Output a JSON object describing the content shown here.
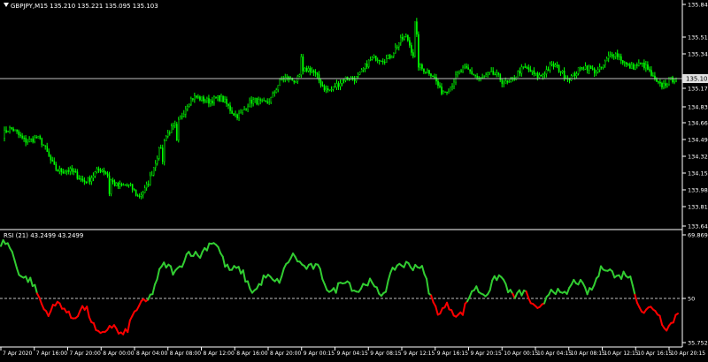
{
  "price_chart": {
    "header_text": "GBPJPY,M15  135.210 135.221 135.095 135.103",
    "y_ticks": [
      "135.845",
      "135.510",
      "135.340",
      "135.170",
      "134.830",
      "134.660",
      "134.490",
      "134.320",
      "134.150",
      "133.980",
      "133.810",
      "133.645"
    ],
    "current_price": "135.103",
    "candle_color": "#00ff00",
    "price_line_color": "#c0c0c0"
  },
  "rsi_panel": {
    "header_text": "RSI (21) 43.2499 43.2499",
    "y_ticks": [
      "69.8691",
      "50",
      "35.752"
    ],
    "level": 50,
    "up_color": "#32cd32",
    "down_color": "#ff0000"
  },
  "time_axis": {
    "labels": [
      "7 Apr 2020",
      "7 Apr 16:00",
      "7 Apr 20:00",
      "8 Apr 00:00",
      "8 Apr 04:00",
      "8 Apr 08:00",
      "8 Apr 12:00",
      "8 Apr 16:00",
      "8 Apr 20:00",
      "9 Apr 00:15",
      "9 Apr 04:15",
      "9 Apr 08:15",
      "9 Apr 12:15",
      "9 Apr 16:15",
      "9 Apr 20:15",
      "10 Apr 00:15",
      "10 Apr 04:15",
      "10 Apr 08:15",
      "10 Apr 12:15",
      "10 Apr 16:15",
      "10 Apr 20:15"
    ]
  },
  "chart_data": [
    {
      "type": "candlestick",
      "title": "GBPJPY,M15",
      "ohlc_readout": {
        "open": 135.21,
        "high": 135.221,
        "low": 135.095,
        "close": 135.103
      },
      "ylim": [
        133.645,
        135.845
      ],
      "close_path": [
        {
          "x": "7 Apr 2020",
          "y": 134.55
        },
        {
          "x": "7 Apr 16:00",
          "y": 134.45
        },
        {
          "x": "7 Apr 20:00",
          "y": 134.2
        },
        {
          "x": "8 Apr 00:00",
          "y": 134.1
        },
        {
          "x": "8 Apr 04:00",
          "y": 133.95
        },
        {
          "x": "8 Apr 08:00",
          "y": 134.65
        },
        {
          "x": "8 Apr 12:00",
          "y": 134.9
        },
        {
          "x": "8 Apr 16:00",
          "y": 134.85
        },
        {
          "x": "8 Apr 20:00",
          "y": 134.9
        },
        {
          "x": "9 Apr 00:15",
          "y": 135.2
        },
        {
          "x": "9 Apr 04:15",
          "y": 135.05
        },
        {
          "x": "9 Apr 08:15",
          "y": 135.2
        },
        {
          "x": "9 Apr 12:15",
          "y": 135.55
        },
        {
          "x": "9 Apr 16:15",
          "y": 134.95
        },
        {
          "x": "9 Apr 20:15",
          "y": 135.18
        },
        {
          "x": "10 Apr 00:15",
          "y": 135.15
        },
        {
          "x": "10 Apr 04:15",
          "y": 135.12
        },
        {
          "x": "10 Apr 08:15",
          "y": 135.22
        },
        {
          "x": "10 Apr 12:15",
          "y": 135.28
        },
        {
          "x": "10 Apr 16:15",
          "y": 135.18
        },
        {
          "x": "10 Apr 20:15",
          "y": 135.103
        }
      ]
    },
    {
      "type": "line",
      "title": "RSI (21)",
      "ylim": [
        35.752,
        69.8691
      ],
      "level": 50,
      "values": [
        {
          "x": "7 Apr 2020",
          "y": 67
        },
        {
          "x": "7 Apr 16:00",
          "y": 51
        },
        {
          "x": "7 Apr 20:00",
          "y": 46
        },
        {
          "x": "8 Apr 00:00",
          "y": 39
        },
        {
          "x": "8 Apr 04:00",
          "y": 44
        },
        {
          "x": "8 Apr 08:00",
          "y": 60
        },
        {
          "x": "8 Apr 12:00",
          "y": 67
        },
        {
          "x": "8 Apr 16:00",
          "y": 57
        },
        {
          "x": "8 Apr 20:00",
          "y": 55
        },
        {
          "x": "9 Apr 00:15",
          "y": 62
        },
        {
          "x": "9 Apr 04:15",
          "y": 53
        },
        {
          "x": "9 Apr 08:15",
          "y": 52
        },
        {
          "x": "9 Apr 12:15",
          "y": 63
        },
        {
          "x": "9 Apr 16:15",
          "y": 45
        },
        {
          "x": "9 Apr 20:15",
          "y": 51
        },
        {
          "x": "10 Apr 00:15",
          "y": 54
        },
        {
          "x": "10 Apr 04:15",
          "y": 48
        },
        {
          "x": "10 Apr 08:15",
          "y": 53
        },
        {
          "x": "10 Apr 12:15",
          "y": 60
        },
        {
          "x": "10 Apr 16:15",
          "y": 47
        },
        {
          "x": "10 Apr 20:15",
          "y": 43.25
        }
      ]
    }
  ]
}
